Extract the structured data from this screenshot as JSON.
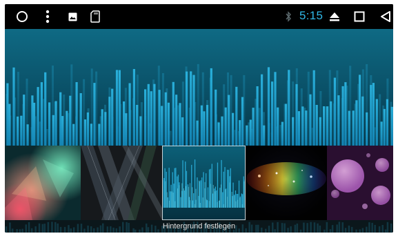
{
  "status_bar": {
    "time": "5:15",
    "clock_color": "#30b8e8",
    "left_icons": [
      "circle-home-icon",
      "overflow-menu-icon",
      "image-icon",
      "sd-card-icon"
    ],
    "right_icons": [
      "bluetooth-icon",
      "eject-icon",
      "square-recents-icon",
      "back-triangle-icon"
    ]
  },
  "wallpaper_picker": {
    "action_label": "Hintergrund festlegen",
    "selected_index": 2,
    "thumbnails": [
      {
        "theme": "soft-color-bokeh-shards"
      },
      {
        "theme": "dark-glass-diagonal-lines"
      },
      {
        "theme": "blue-audio-equalizer"
      },
      {
        "theme": "rainbow-particle-glow"
      },
      {
        "theme": "purple-bubble-bokeh"
      }
    ]
  },
  "colors": {
    "preview_top": "#0f6a84",
    "preview_bottom": "#052d3a",
    "equalizer_bar": "#1fa5d4"
  }
}
